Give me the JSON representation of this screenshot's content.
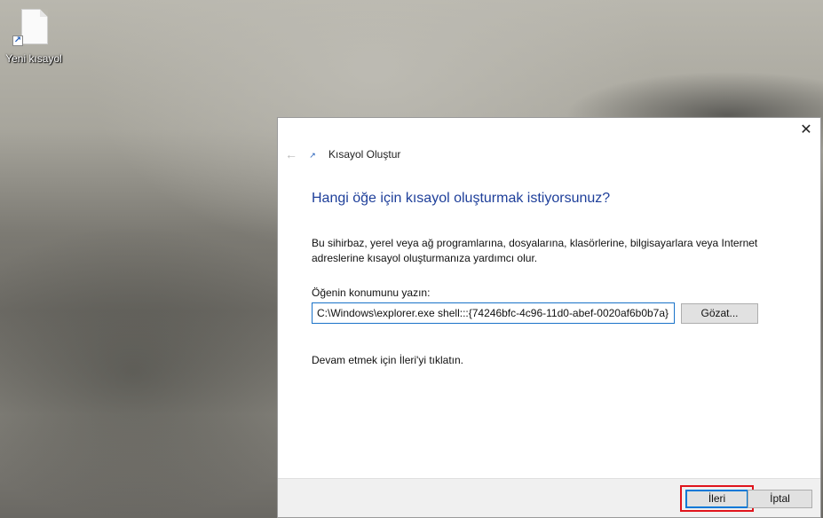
{
  "desktop": {
    "shortcut": {
      "label": "Yeni kısayol",
      "icon": "file-shortcut-icon",
      "badge_glyph": "↗"
    }
  },
  "dialog": {
    "close_glyph": "✕",
    "back_glyph": "←",
    "title_icon_glyph": "↗",
    "title": "Kısayol Oluştur",
    "heading": "Hangi öğe için kısayol oluşturmak istiyorsunuz?",
    "description": "Bu sihirbaz, yerel veya ağ programlarına, dosyalarına, klasörlerine, bilgisayarlara veya Internet adreslerine kısayol oluşturmanıza yardımcı olur.",
    "location_label": "Öğenin konumunu yazın:",
    "location_value": "C:\\Windows\\explorer.exe shell:::{74246bfc-4c96-11d0-abef-0020af6b0b7a}",
    "browse_label": "Gözat...",
    "continue_hint": "Devam etmek için İleri'yi tıklatın.",
    "footer": {
      "next_label": "İleri",
      "cancel_label": "İptal"
    }
  },
  "colors": {
    "heading": "#1e3f9a",
    "input_border": "#1a73c9",
    "highlight": "#e0141c",
    "footer_bg": "#f0f0f0"
  }
}
